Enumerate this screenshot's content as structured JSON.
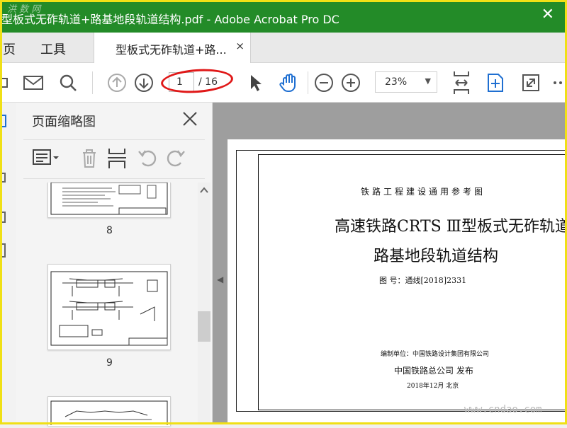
{
  "window": {
    "title": "型板式无砟轨道+路基地段轨道结构.pdf - Adobe Acrobat Pro DC",
    "watermark": "洪 数 网",
    "close_glyph": "✕"
  },
  "menu": {
    "home": "页",
    "tools": "工具"
  },
  "tab": {
    "label": "型板式无砟轨道+路...",
    "close_glyph": "×"
  },
  "toolbar": {
    "page_current": "1",
    "page_total": "/ 16",
    "zoom": "23%",
    "zoom_caret": "▼"
  },
  "panel": {
    "title": "页面缩略图",
    "thumbnails": [
      {
        "label": "8"
      },
      {
        "label": "9"
      }
    ]
  },
  "document": {
    "caption": "铁路工程建设通用参考图",
    "title_line1": "高速铁路CRTS  Ⅲ型板式无砟轨道",
    "title_line2": "路基地段轨道结构",
    "drawing_no": "图  号：通线[2018]2331",
    "editor": "编制单位：中国铁路设计集团有限公司",
    "publisher": "中国铁路总公司    发布",
    "date": "2018年12月     北京"
  },
  "watermark_bottom": "www.cndao.com",
  "colors": {
    "titlebar": "#238b28",
    "accent_blue": "#1f6fd1",
    "annotation_red": "#e01818"
  }
}
